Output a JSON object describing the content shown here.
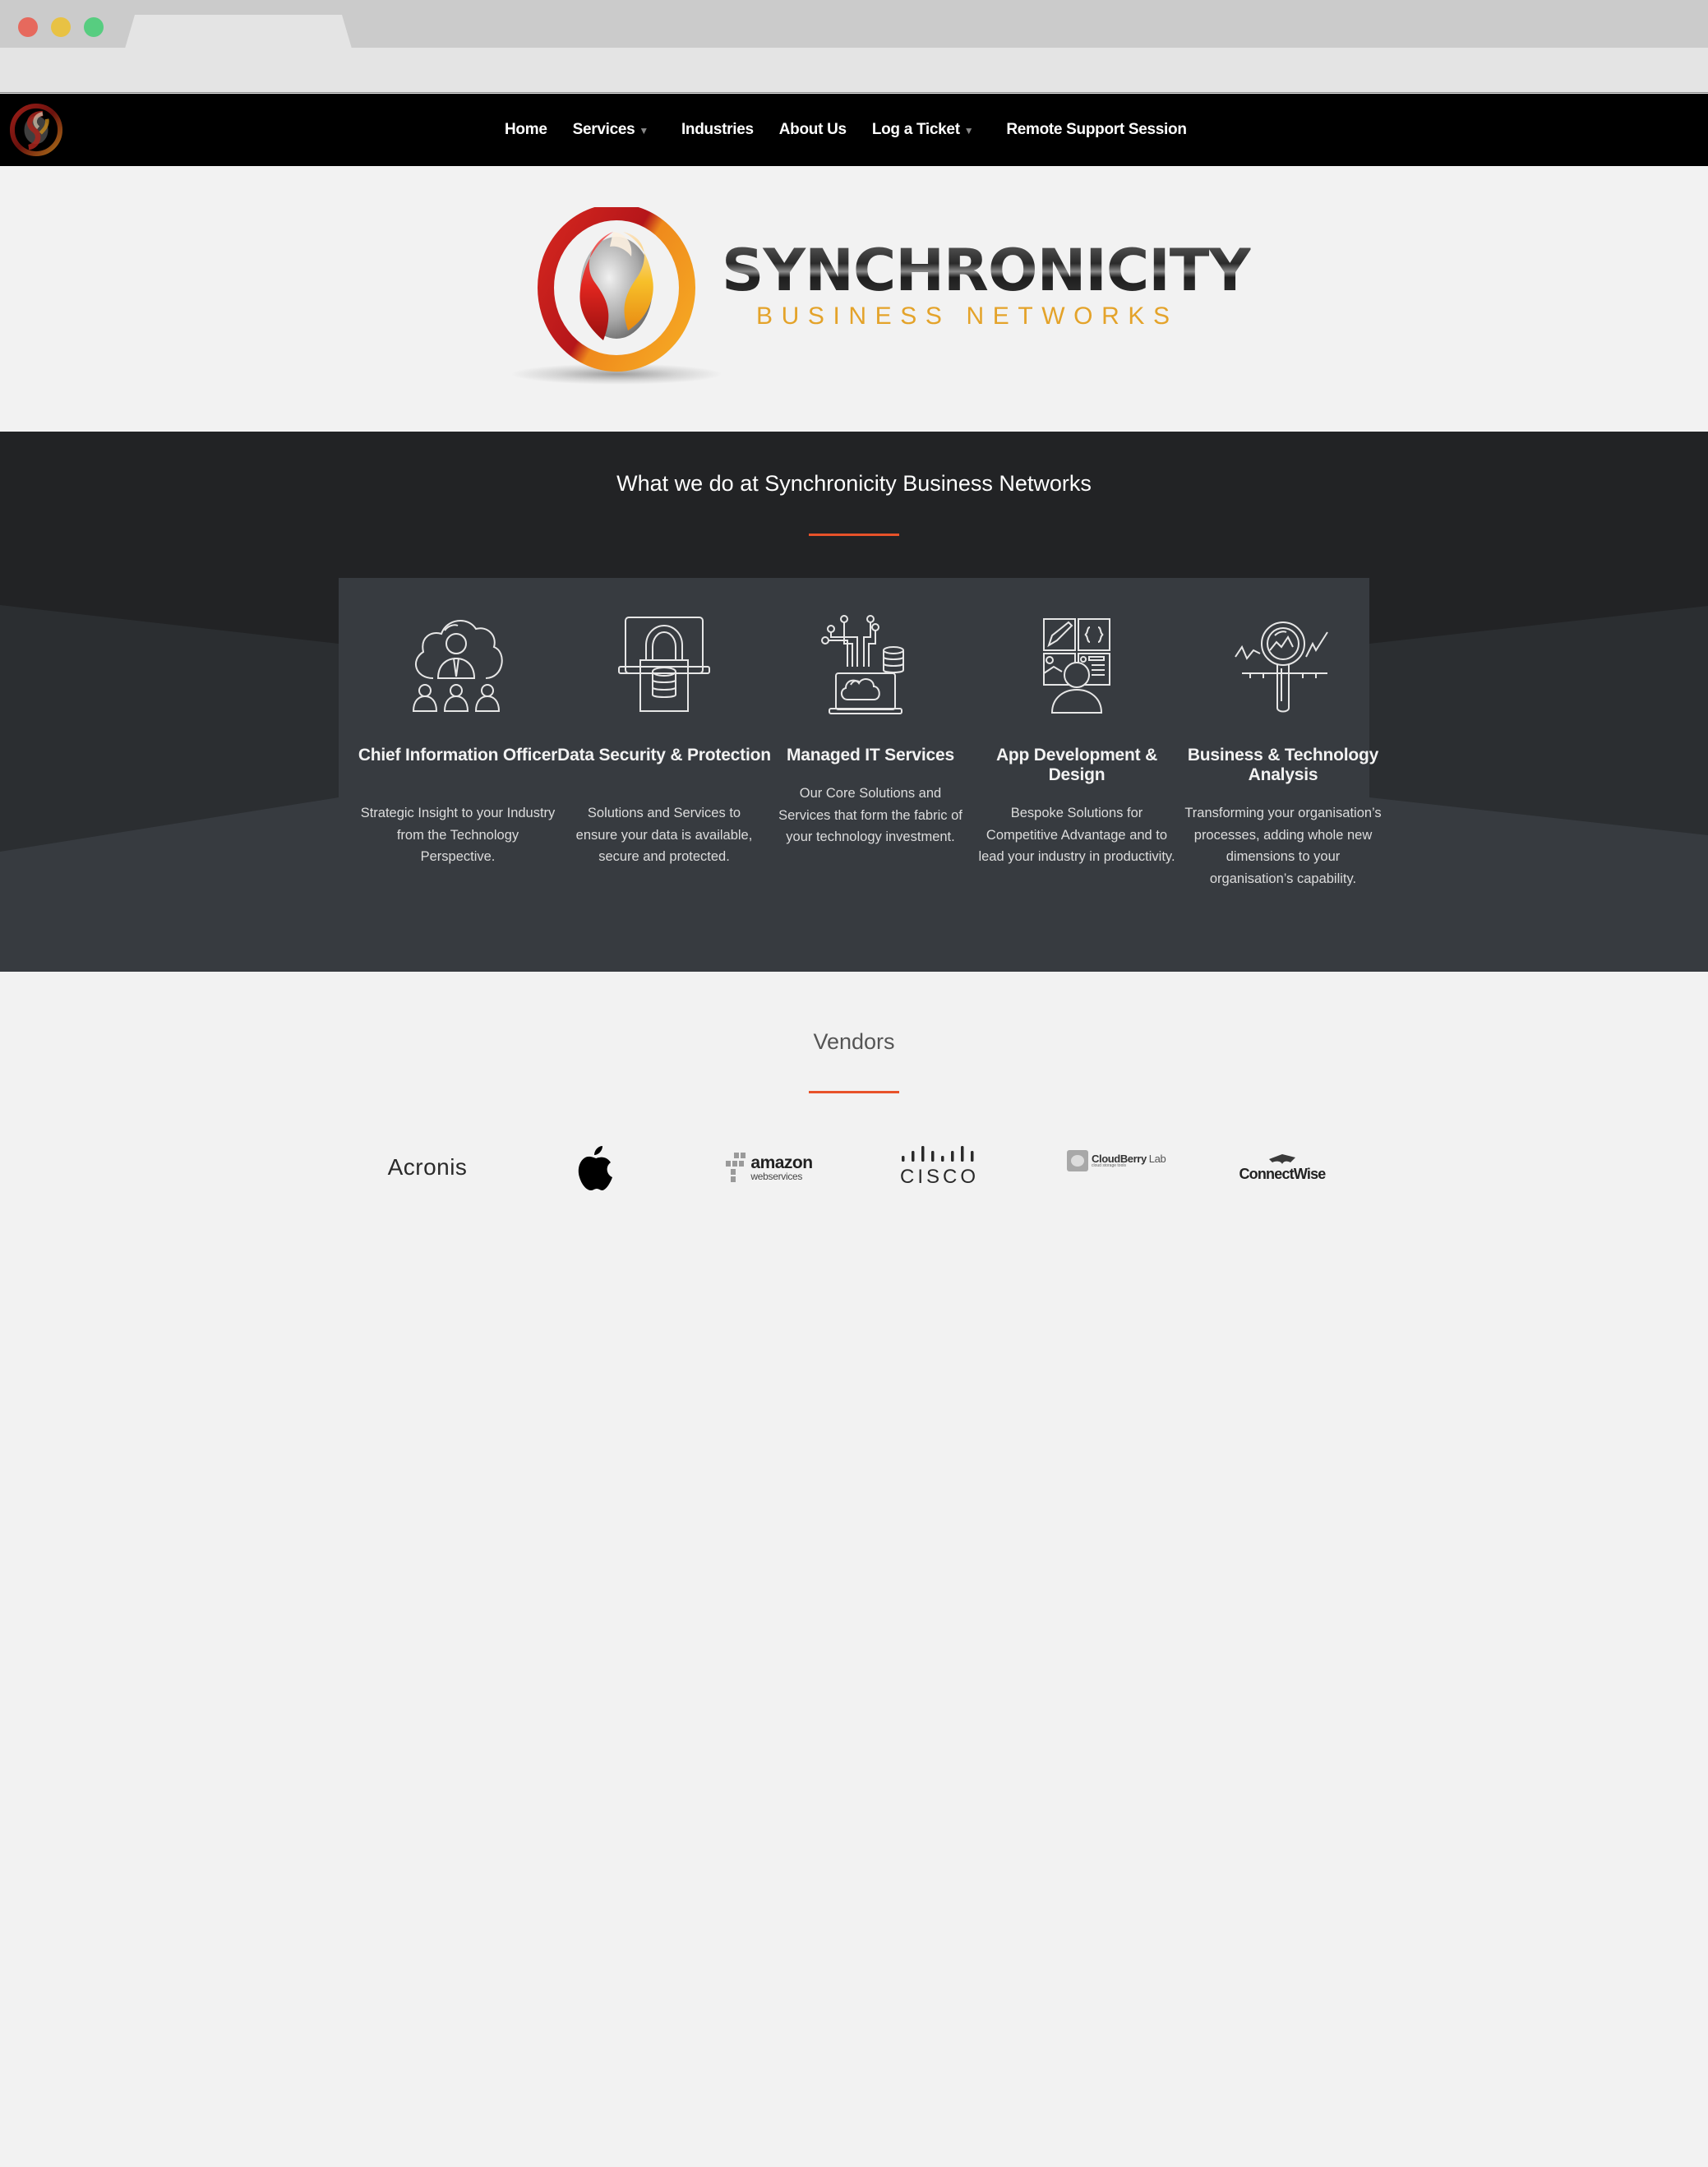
{
  "browser": {
    "traffic_lights": [
      "close",
      "minimize",
      "maximize"
    ],
    "tab_title": ""
  },
  "nav": {
    "logo_alt": "Synchronicity logo",
    "items": [
      {
        "label": "Home",
        "has_dropdown": false
      },
      {
        "label": "Services",
        "has_dropdown": true
      },
      {
        "label": "Industries",
        "has_dropdown": false
      },
      {
        "label": "About Us",
        "has_dropdown": false
      },
      {
        "label": "Log a Ticket",
        "has_dropdown": true
      },
      {
        "label": "Remote Support Session",
        "has_dropdown": false
      }
    ],
    "dropdown_caret": "▼"
  },
  "hero": {
    "brand_name": "SYNCHRONICITY",
    "brand_subtitle": "BUSINESS NETWORKS"
  },
  "services": {
    "heading": "What we do at Synchronicity Business Networks",
    "items": [
      {
        "icon": "cloud-executive-team-icon",
        "title": "Chief Information Officer",
        "description": "Strategic Insight to your Industry from the Technology Perspective."
      },
      {
        "icon": "padlock-database-icon",
        "title": "Data Security & Protection",
        "description": "Solutions and Services to ensure your data is available, secure and protected."
      },
      {
        "icon": "laptop-cloud-circuit-icon",
        "title": "Managed IT Services",
        "description": "Our Core Solutions and Services that form the fabric of your technology investment."
      },
      {
        "icon": "app-design-person-icon",
        "title": "App Development & Design",
        "description": "Bespoke Solutions for Competitive Advantage and to lead your industry in productivity."
      },
      {
        "icon": "magnifier-analysis-icon",
        "title": "Business & Technology Analysis",
        "description": "Transforming your organisation’s processes, adding whole new dimensions to your organisation’s capability."
      }
    ]
  },
  "vendors": {
    "heading": "Vendors",
    "items": [
      {
        "name": "Acronis",
        "logo_text": "Acronis"
      },
      {
        "name": "Apple",
        "logo_text": ""
      },
      {
        "name": "Amazon Web Services",
        "logo_text": "amazon",
        "logo_subtext": "webservices"
      },
      {
        "name": "Cisco",
        "logo_text": "CISCO"
      },
      {
        "name": "CloudBerry Lab",
        "logo_text": "CloudBerry",
        "logo_text2": "Lab",
        "logo_subtext": "cloud storage tools"
      },
      {
        "name": "ConnectWise",
        "logo_text": "ConnectWise"
      }
    ]
  },
  "colors": {
    "accent": "#e8522a",
    "nav_bg": "#000000",
    "services_bg": "#222325",
    "panel_bg": "#373b40",
    "brand_gold": "#e4a32a",
    "page_bg": "#f2f2f2"
  }
}
